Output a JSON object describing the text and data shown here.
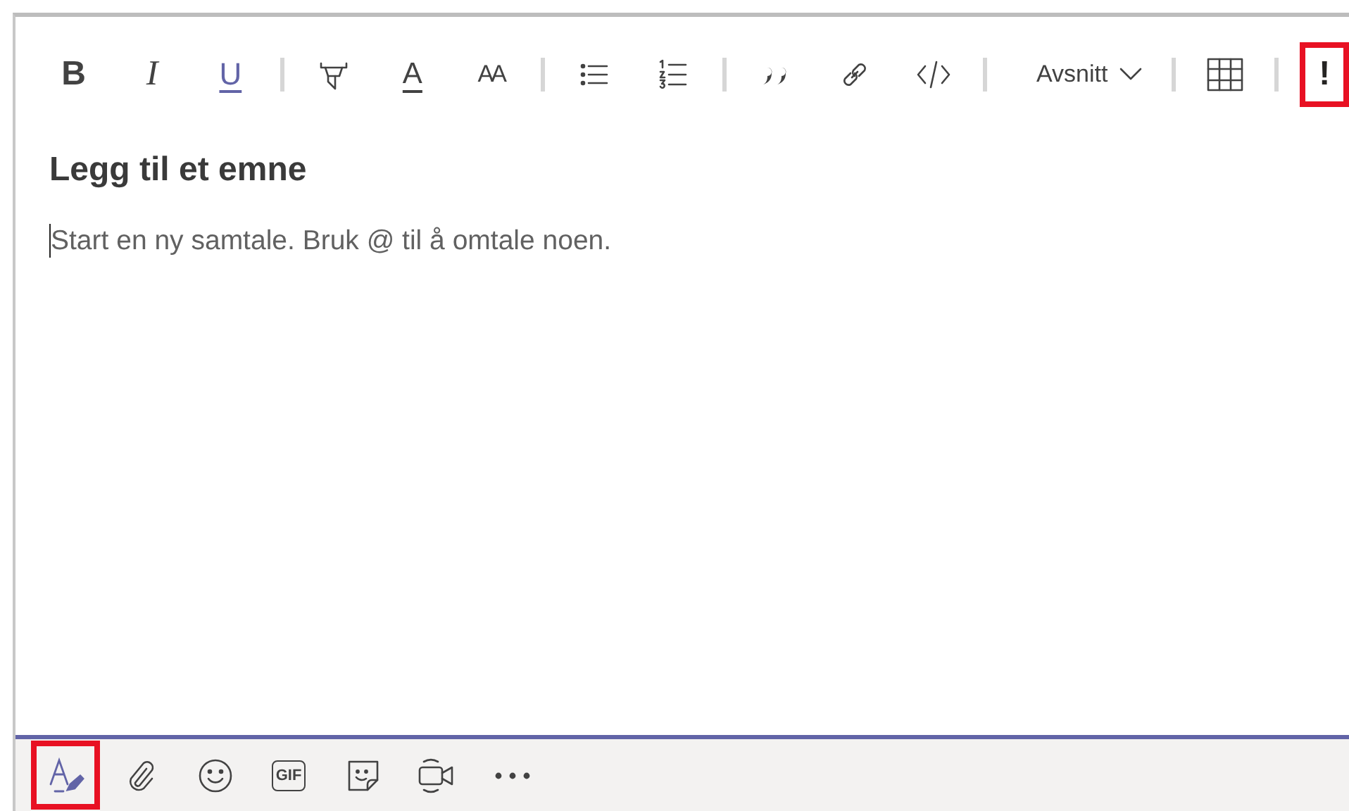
{
  "toolbar": [
    {
      "kind": "bold",
      "label": "B"
    },
    {
      "kind": "italic",
      "label": "I"
    },
    {
      "kind": "underline",
      "label": "U"
    },
    {
      "kind": "separator"
    },
    {
      "kind": "highlighter"
    },
    {
      "kind": "fontcolor",
      "label": "A"
    },
    {
      "kind": "fontsize",
      "label": "AA"
    },
    {
      "kind": "separator"
    },
    {
      "kind": "bullets"
    },
    {
      "kind": "numbers"
    },
    {
      "kind": "separator"
    },
    {
      "kind": "quote"
    },
    {
      "kind": "link"
    },
    {
      "kind": "code"
    },
    {
      "kind": "separator"
    },
    {
      "kind": "dropdown",
      "label": "Avsnitt"
    },
    {
      "kind": "separator"
    },
    {
      "kind": "table"
    },
    {
      "kind": "separator"
    },
    {
      "kind": "important",
      "label": "!",
      "highlighted": true
    }
  ],
  "subject": {
    "placeholder": "Legg til et emne"
  },
  "message": {
    "placeholder": "Start en ny samtale. Bruk @ til å omtale noen.",
    "focused": true
  },
  "actions": [
    {
      "kind": "format",
      "highlighted": true
    },
    {
      "kind": "attach",
      "highlighted": false
    },
    {
      "kind": "emoji",
      "highlighted": false
    },
    {
      "kind": "gif",
      "label": "GIF",
      "highlighted": false
    },
    {
      "kind": "sticker",
      "highlighted": false
    },
    {
      "kind": "meet",
      "highlighted": false
    },
    {
      "kind": "more",
      "highlighted": false
    }
  ]
}
